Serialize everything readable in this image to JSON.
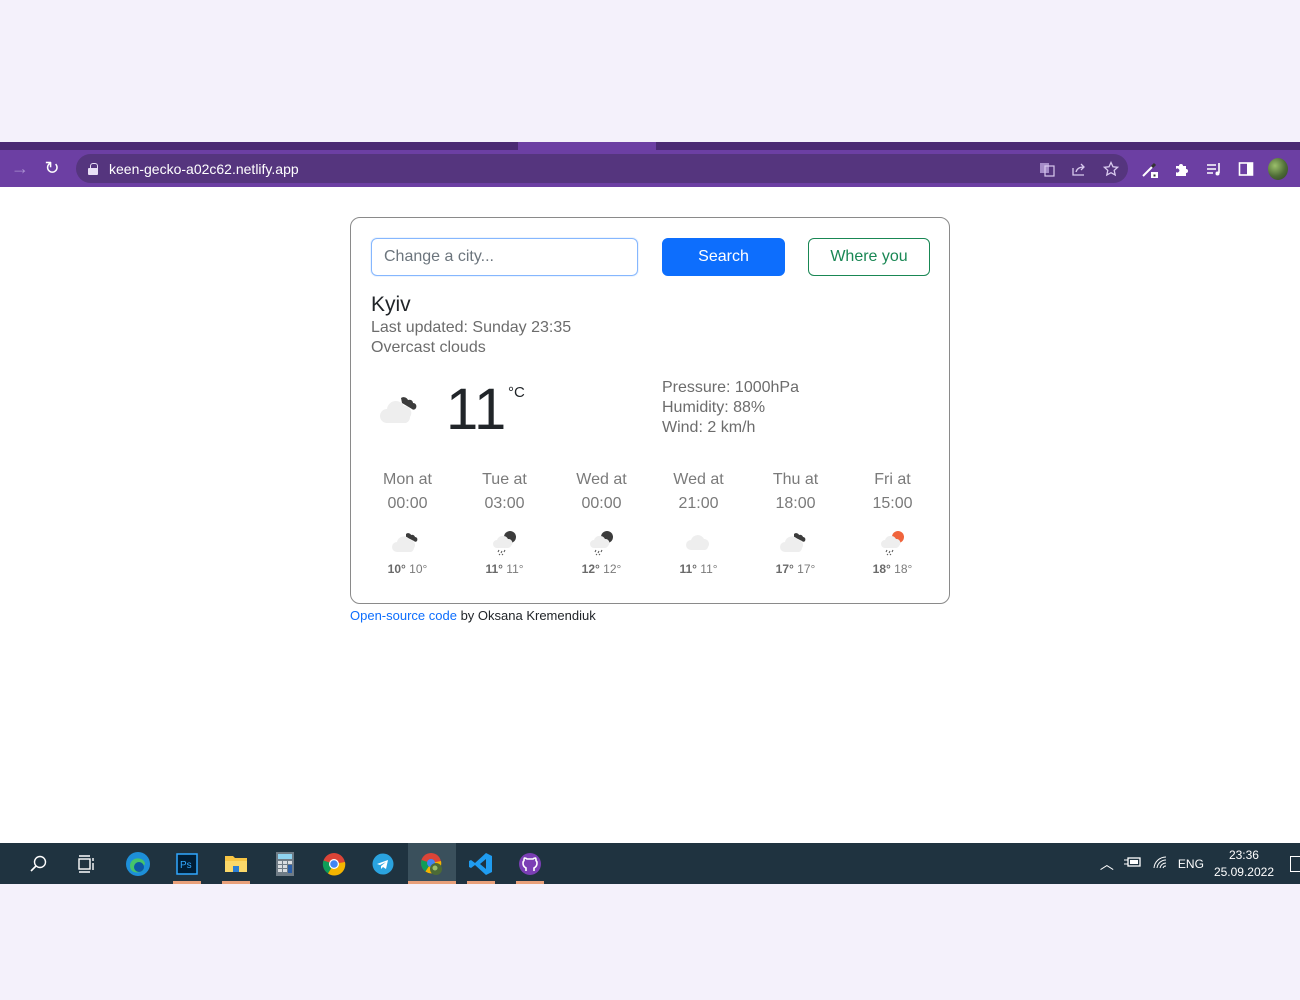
{
  "browser": {
    "url": "keen-gecko-a02c62.netlify.app",
    "nav": {
      "forward_icon": "arrow-right-icon",
      "reload_icon": "reload-icon"
    },
    "omnibox_icons": [
      "translate-icon",
      "share-icon",
      "bookmark-star-icon"
    ],
    "extension_icons": [
      "eyedropper-icon",
      "puzzle-icon",
      "media-playlist-icon",
      "side-panel-icon",
      "profile-avatar"
    ]
  },
  "weather": {
    "search": {
      "placeholder": "Change a city...",
      "value": ""
    },
    "search_button": "Search",
    "location_button": "Where you",
    "city": "Kyiv",
    "last_updated": "Last updated: Sunday 23:35",
    "description": "Overcast clouds",
    "current_icon": "broken-clouds-night-icon",
    "temperature": "11",
    "unit": "°C",
    "pressure": "Pressure: 1000hPa",
    "humidity": "Humidity: 88%",
    "wind": "Wind: 2 km/h",
    "forecast": [
      {
        "day": "Mon at",
        "time": "00:00",
        "icon": "broken-clouds-night-icon",
        "max": "10°",
        "min": "10°"
      },
      {
        "day": "Tue at",
        "time": "03:00",
        "icon": "rain-night-icon",
        "max": "11°",
        "min": "11°"
      },
      {
        "day": "Wed at",
        "time": "00:00",
        "icon": "rain-night-icon",
        "max": "12°",
        "min": "12°"
      },
      {
        "day": "Wed at",
        "time": "21:00",
        "icon": "cloud-icon",
        "max": "11°",
        "min": "11°"
      },
      {
        "day": "Thu at",
        "time": "18:00",
        "icon": "broken-clouds-night-icon",
        "max": "17°",
        "min": "17°"
      },
      {
        "day": "Fri at",
        "time": "15:00",
        "icon": "rain-day-icon",
        "max": "18°",
        "min": "18°"
      }
    ]
  },
  "footer": {
    "link": "Open-source code",
    "text": " by Oksana Kremendiuk"
  },
  "taskbar": {
    "apps": [
      "search",
      "task-view",
      "edge",
      "photoshop",
      "file-explorer",
      "calculator",
      "chrome",
      "telegram",
      "chrome-profile",
      "vscode",
      "github-desktop"
    ],
    "tray": {
      "language": "ENG",
      "time": "23:36",
      "date": "25.09.2022"
    },
    "colors": {
      "underline": "#e8a07a",
      "background": "#1f3340"
    }
  },
  "colors": {
    "browser_theme": "#6c3fa3",
    "primary": "#0d6efd",
    "success": "#198754",
    "rain_sun": "#f0643c"
  }
}
